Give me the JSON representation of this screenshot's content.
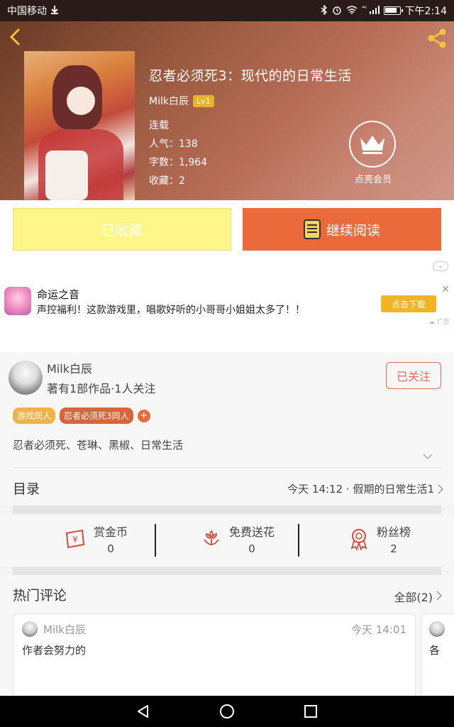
{
  "status_bar": {
    "carrier": "中国移动",
    "signal": "⁴⁶",
    "time": "下午2:14"
  },
  "header": {
    "back_icon": "back-arrow-icon",
    "share_icon": "share-icon",
    "title": "忍者必须死3：现代的的日常生活",
    "author": "Milk白辰",
    "level": "Lv1",
    "status": "连载",
    "popularity": "人气：138",
    "word_count": "字数：1,964",
    "favorites": "收藏：2",
    "vip_label": "点亮会员"
  },
  "actions": {
    "collected_label": "已收藏",
    "read_label": "继续阅读"
  },
  "ad": {
    "title": "命运之音",
    "description": "声控福利！这款游戏里，唱歌好听的小哥哥小姐姐太多了！！",
    "download_label": "点击下载",
    "tag": "广告",
    "close_symbol": "✕"
  },
  "author_info": {
    "name": "Milk白辰",
    "stats": "著有1部作品·1人关注",
    "follow_label": "已关注",
    "tags": [
      "游戏同人",
      "忍者必须死3同人"
    ],
    "add_tag": "+",
    "keywords": "忍者必须死、苍琳、黑椒、日常生活"
  },
  "catalog": {
    "label": "目录",
    "latest": "今天 14:12 · 假期的日常生活1"
  },
  "stats": [
    {
      "label": "赏金币",
      "value": "0",
      "icon": "coin-envelope-icon"
    },
    {
      "label": "免费送花",
      "value": "0",
      "icon": "flower-icon"
    },
    {
      "label": "粉丝榜",
      "value": "2",
      "icon": "ribbon-award-icon"
    }
  ],
  "comments": {
    "title": "热门评论",
    "all_label": "全部(2)",
    "items": [
      {
        "author": "Milk白辰",
        "time": "今天 14:01",
        "text": "作者会努力的"
      },
      {
        "author": "",
        "time": "",
        "text": "各"
      }
    ]
  },
  "colors": {
    "accent_orange": "#eb6a3c",
    "collected_yellow": "#fff68a",
    "follow_red": "#e46a5e",
    "ad_button": "#f0b425"
  }
}
